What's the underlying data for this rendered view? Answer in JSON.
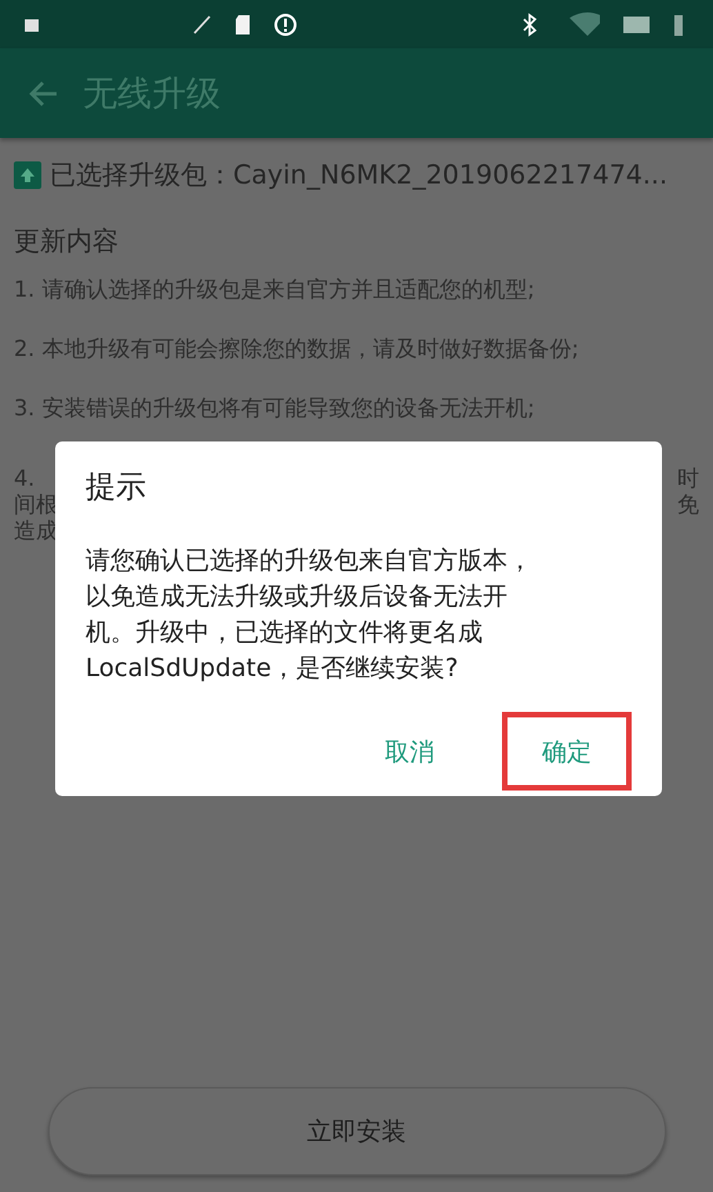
{
  "app_bar": {
    "title": "无线升级"
  },
  "package": {
    "label": "已选择升级包：Cayin_N6MK2_2019062217474..."
  },
  "section_title": "更新内容",
  "notes": [
    "1. 请确认选择的升级包是来自官方并且适配您的机型;",
    "2. 本地升级有可能会擦除您的数据，请及时做好数据备份;",
    "3. 安装错误的升级包将有可能导致您的设备无法开机;"
  ],
  "covered_note": {
    "left_lines": [
      "4.",
      "间根",
      "造成"
    ],
    "right_lines": [
      "时",
      "免"
    ]
  },
  "dialog": {
    "title": "提示",
    "message": "请您确认已选择的升级包来自官方版本，以免造成无法升级或升级后设备无法开机。升级中，已选择的文件将更名成LocalSdUpdate，是否继续安装?",
    "buttons": [
      {
        "label": "取消",
        "highlighted": false
      },
      {
        "label": "确定",
        "highlighted": true
      }
    ]
  },
  "install_button": "立即安装"
}
